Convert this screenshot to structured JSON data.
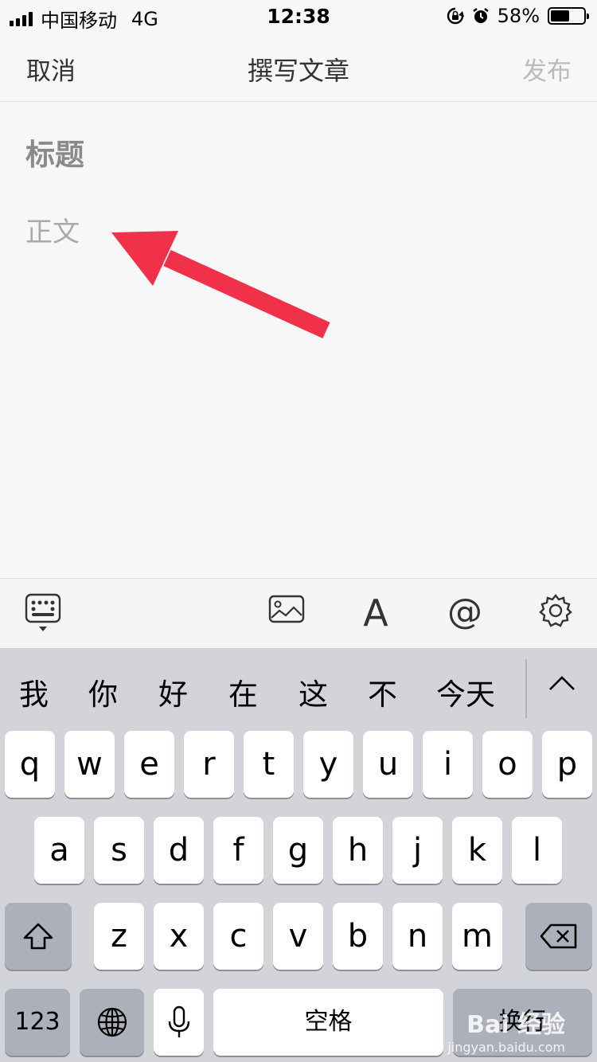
{
  "status_bar": {
    "carrier": "中国移动",
    "network": "4G",
    "time": "12:38",
    "battery": "58%",
    "battery_level": 0.58,
    "icons": [
      "signal-icon",
      "rotation-lock-icon",
      "alarm-icon",
      "battery-icon"
    ]
  },
  "nav": {
    "cancel": "取消",
    "title": "撰写文章",
    "publish": "发布"
  },
  "editor": {
    "title_placeholder": "标题",
    "body_placeholder": "正文",
    "arrow_color": "#f1304a"
  },
  "toolbar": {
    "icons": [
      "keyboard-toggle-icon",
      "image-icon",
      "text-format-icon",
      "at-mention-icon",
      "settings-gear-icon"
    ],
    "format_glyph": "A",
    "at_glyph": "@"
  },
  "keyboard": {
    "candidates": [
      "我",
      "你",
      "好",
      "在",
      "这",
      "不",
      "今天"
    ],
    "expand_glyph": "^",
    "row1": [
      "q",
      "w",
      "e",
      "r",
      "t",
      "y",
      "u",
      "i",
      "o",
      "p"
    ],
    "row2": [
      "a",
      "s",
      "d",
      "f",
      "g",
      "h",
      "j",
      "k",
      "l"
    ],
    "row3": [
      "z",
      "x",
      "c",
      "v",
      "b",
      "n",
      "m"
    ],
    "numbers_key": "123",
    "space_key": "空格",
    "return_key": "换行"
  },
  "watermark": {
    "brand": "Bai 经验",
    "url": "jingyan.baidu.com"
  }
}
